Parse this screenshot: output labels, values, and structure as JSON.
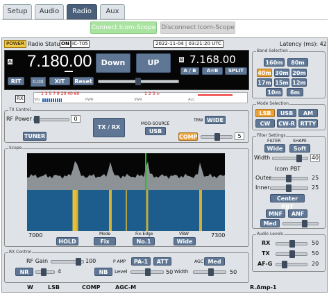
{
  "tabs": [
    "Setup",
    "Audio",
    "Radio",
    "Aux"
  ],
  "active_tab": "Radio",
  "connect": {
    "connect_label": "Connect Icom-Scope",
    "disconnect_label": "Disconnect Icom-Scope"
  },
  "status": {
    "power_label": "POWER",
    "radio_status_label": "Radio Status:",
    "radio_on": "ON",
    "model": "IC-705",
    "datetime": "2022-11-04 | 03:21:20 UTC",
    "latency": "Latency (ms): 42"
  },
  "vfo": {
    "a_label": "A",
    "b_label": "B",
    "a_freq": "7.180.00",
    "b_freq": "7.168.00",
    "down": "Down",
    "up": "UP",
    "ab_swap": "A / B",
    "a_eq_b": "A=B",
    "split": "SPLIT",
    "rit": "RIT",
    "rit_val": "0.00",
    "xit": "XIT",
    "reset": "Reset"
  },
  "meters": {
    "rx_label": "RX",
    "sig": "SIG",
    "sig_scale": "1 3 5 7 9 20 40 60",
    "pwr": "PWR",
    "swr": "SWR",
    "swr_scale": "1  2  3  ∞",
    "alc": "ALC"
  },
  "bands": {
    "title": "Band Selection",
    "items": [
      "160m",
      "80m",
      "40m",
      "30m",
      "20m",
      "17m",
      "15m",
      "12m",
      "10m",
      "6m"
    ],
    "selected": "40m"
  },
  "modes": {
    "title": "Mode Selection",
    "items": [
      "LSB",
      "USB",
      "AM",
      "CW",
      "CW-R",
      "RTTY"
    ],
    "selected": "LSB"
  },
  "tx": {
    "title": "TX Control",
    "rf_power": "RF Power",
    "rf_val": "0",
    "tune": "TUNER",
    "txrx": "TX / RX",
    "mod_source": "MOD-SOURCE",
    "mod_val": "USB",
    "tbw": "TBW",
    "tbw_val": "WIDE",
    "comp": "COMP",
    "comp_val": "5"
  },
  "filters": {
    "title": "Filter Settings",
    "filter": "FILTER",
    "shape": "SHAPE",
    "filter_val": "Wide",
    "shape_val": "Soft",
    "width": "Width",
    "width_val": "40",
    "pbt_title": "Icom PBT",
    "outer": "Outer",
    "outer_val": "25",
    "inner": "Inner",
    "inner_val": "25",
    "center": "Center PBT",
    "mnf": "MNF",
    "anf": "ANF",
    "nr_med": "Med"
  },
  "scope": {
    "title": "Scope",
    "left": "7000",
    "right": "7300",
    "hold": "HOLD",
    "mode_lbl": "Mode",
    "mode_val": "Fix",
    "edge_lbl": "Fix-Edge",
    "edge_val": "No.1",
    "vbw_lbl": "VBW",
    "vbw_val": "Wide"
  },
  "audio": {
    "title": "Audio Levels",
    "rx": "RX",
    "rx_val": "50",
    "tx": "TX",
    "tx_val": "50",
    "af": "AF-G",
    "af_val": "20"
  },
  "rxc": {
    "title": "RX Control",
    "rf_gain": "RF Gain",
    "rf_gain_val": "100",
    "pamp": "P AMP",
    "pamp_val": "PA-1",
    "att": "ATT",
    "agc": "AGC",
    "agc_val": "Med",
    "nr": "NR",
    "nr_val": "4",
    "nb": "NB",
    "level": "Level",
    "level_val": "50",
    "width": "Width",
    "width_val": "50"
  },
  "footer": [
    "W",
    "LSB",
    "COMP",
    "AGC-M",
    "R.Amp-1"
  ]
}
